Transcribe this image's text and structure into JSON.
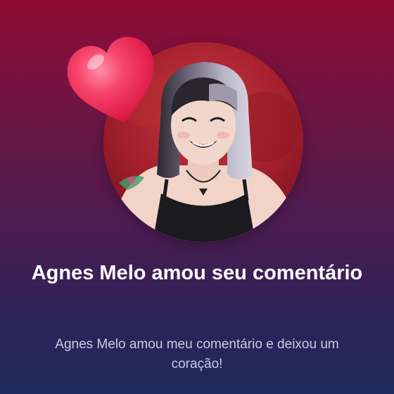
{
  "notification": {
    "title": "Agnes Melo amou seu comentário",
    "message": "Agnes Melo amou meu comentário e deixou um coração!"
  },
  "avatar": {
    "icon": "profile-photo"
  },
  "reaction": {
    "icon": "heart-icon",
    "color": "#f0325e"
  },
  "colors": {
    "background_top": "#8e0c33",
    "background_bottom": "#1f2a5c",
    "title": "#ffffff",
    "message": "#c7cde6"
  }
}
